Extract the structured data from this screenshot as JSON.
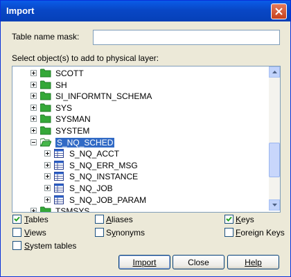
{
  "window": {
    "title": "Import"
  },
  "form": {
    "mask_label": "Table name mask:",
    "mask_value": "",
    "select_label": "Select object(s) to add to physical layer:"
  },
  "tree": {
    "items": [
      {
        "label": "SCOTT",
        "type": "folder"
      },
      {
        "label": "SH",
        "type": "folder"
      },
      {
        "label": "SI_INFORMTN_SCHEMA",
        "type": "folder"
      },
      {
        "label": "SYS",
        "type": "folder"
      },
      {
        "label": "SYSMAN",
        "type": "folder"
      },
      {
        "label": "SYSTEM",
        "type": "folder"
      },
      {
        "label": "S_NQ_SCHED",
        "type": "folder",
        "expanded": true,
        "selected": true
      },
      {
        "label": "S_NQ_ACCT",
        "type": "table"
      },
      {
        "label": "S_NQ_ERR_MSG",
        "type": "table"
      },
      {
        "label": "S_NQ_INSTANCE",
        "type": "table"
      },
      {
        "label": "S_NQ_JOB",
        "type": "table"
      },
      {
        "label": "S_NQ_JOB_PARAM",
        "type": "table"
      },
      {
        "label": "TSMSYS",
        "type": "folder"
      }
    ]
  },
  "options": {
    "tables": {
      "label": "Tables",
      "checked": true
    },
    "views": {
      "label": "Views",
      "checked": false
    },
    "system_tables": {
      "label": "System tables",
      "checked": false
    },
    "aliases": {
      "label": "Aliases",
      "checked": false
    },
    "synonyms": {
      "label": "Synonyms",
      "checked": false
    },
    "keys": {
      "label": "Keys",
      "checked": true
    },
    "foreign_keys": {
      "label": "Foreign Keys",
      "checked": false
    }
  },
  "buttons": {
    "import": "Import",
    "close": "Close",
    "help": "Help"
  },
  "colors": {
    "titlebar": "#0a5ce8",
    "selection": "#316ac5",
    "folder": "#2f9b35"
  },
  "icons": [
    "close-icon",
    "folder-icon",
    "table-icon",
    "expand-icon",
    "collapse-icon",
    "check-icon"
  ]
}
